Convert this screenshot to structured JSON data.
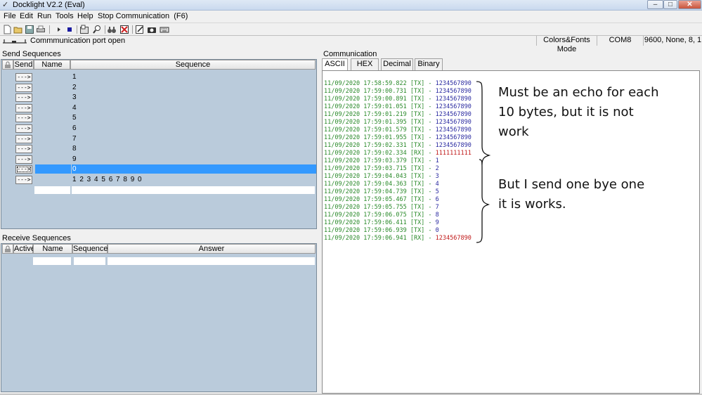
{
  "window": {
    "title": "Docklight V2.2 (Eval)",
    "minimize_glyph": "–",
    "maximize_glyph": "□",
    "close_glyph": "✕"
  },
  "menu": {
    "items": [
      "File",
      "Edit",
      "Run",
      "Tools",
      "Help",
      "Stop Communication  (F6)"
    ]
  },
  "toolbar": {
    "icons": [
      "new-icon",
      "open-icon",
      "save-icon",
      "print-icon",
      "run-icon",
      "stop-icon",
      "project-settings-icon",
      "find-icon",
      "binoculars-icon",
      "clear-icon",
      "edit-icon",
      "snapshot-icon",
      "keyboard-icon"
    ]
  },
  "status": {
    "port_status": "Commmunication port open",
    "mode": "Colors&Fonts Mode",
    "port": "COM8",
    "settings": "9600, None, 8, 1"
  },
  "send_panel": {
    "label": "Send Sequences",
    "columns": [
      "Send",
      "Name",
      "Sequence"
    ],
    "button_label": "--->",
    "rows": [
      "1",
      "2",
      "3",
      "4",
      "5",
      "6",
      "7",
      "8",
      "9",
      "0",
      "1 2 3 4 5 6 7 8 9 0"
    ],
    "selected_row": 9
  },
  "receive_panel": {
    "label": "Receive Sequences",
    "columns": [
      "Active",
      "Name",
      "Sequence",
      "Answer"
    ]
  },
  "comm_panel": {
    "label": "Communication",
    "tabs": [
      "ASCII",
      "HEX",
      "Decimal",
      "Binary"
    ],
    "active_tab": "ASCII",
    "log": [
      {
        "ts": "11/09/2020 17:58:59.822",
        "dir": "[TX]",
        "data": "1234567890"
      },
      {
        "ts": "11/09/2020 17:59:00.731",
        "dir": "[TX]",
        "data": "1234567890"
      },
      {
        "ts": "11/09/2020 17:59:00.891",
        "dir": "[TX]",
        "data": "1234567890"
      },
      {
        "ts": "11/09/2020 17:59:01.051",
        "dir": "[TX]",
        "data": "1234567890"
      },
      {
        "ts": "11/09/2020 17:59:01.219",
        "dir": "[TX]",
        "data": "1234567890"
      },
      {
        "ts": "11/09/2020 17:59:01.395",
        "dir": "[TX]",
        "data": "1234567890"
      },
      {
        "ts": "11/09/2020 17:59:01.579",
        "dir": "[TX]",
        "data": "1234567890"
      },
      {
        "ts": "11/09/2020 17:59:01.955",
        "dir": "[TX]",
        "data": "1234567890"
      },
      {
        "ts": "11/09/2020 17:59:02.331",
        "dir": "[TX]",
        "data": "1234567890"
      },
      {
        "ts": "11/09/2020 17:59:02.334",
        "dir": "[RX]",
        "data": "1111111111"
      },
      {
        "ts": "11/09/2020 17:59:03.379",
        "dir": "[TX]",
        "data": "1"
      },
      {
        "ts": "11/09/2020 17:59:03.715",
        "dir": "[TX]",
        "data": "2"
      },
      {
        "ts": "11/09/2020 17:59:04.043",
        "dir": "[TX]",
        "data": "3"
      },
      {
        "ts": "11/09/2020 17:59:04.363",
        "dir": "[TX]",
        "data": "4"
      },
      {
        "ts": "11/09/2020 17:59:04.739",
        "dir": "[TX]",
        "data": "5"
      },
      {
        "ts": "11/09/2020 17:59:05.467",
        "dir": "[TX]",
        "data": "6"
      },
      {
        "ts": "11/09/2020 17:59:05.755",
        "dir": "[TX]",
        "data": "7"
      },
      {
        "ts": "11/09/2020 17:59:06.075",
        "dir": "[TX]",
        "data": "8"
      },
      {
        "ts": "11/09/2020 17:59:06.411",
        "dir": "[TX]",
        "data": "9"
      },
      {
        "ts": "11/09/2020 17:59:06.939",
        "dir": "[TX]",
        "data": "0"
      },
      {
        "ts": "11/09/2020 17:59:06.941",
        "dir": "[RX]",
        "data": "1234567890"
      }
    ],
    "separator": " - "
  },
  "annotations": {
    "note1": [
      "Must be an echo for each",
      "10 bytes, but it is not",
      "work"
    ],
    "note2": [
      "But I send one bye one",
      "it is works."
    ]
  },
  "colors": {
    "timestamp": "#2a8a2a",
    "tx_data": "#2a2aa0",
    "rx_data": "#c01818",
    "selection": "#3399ff",
    "grid_bg": "#bacbdb"
  }
}
